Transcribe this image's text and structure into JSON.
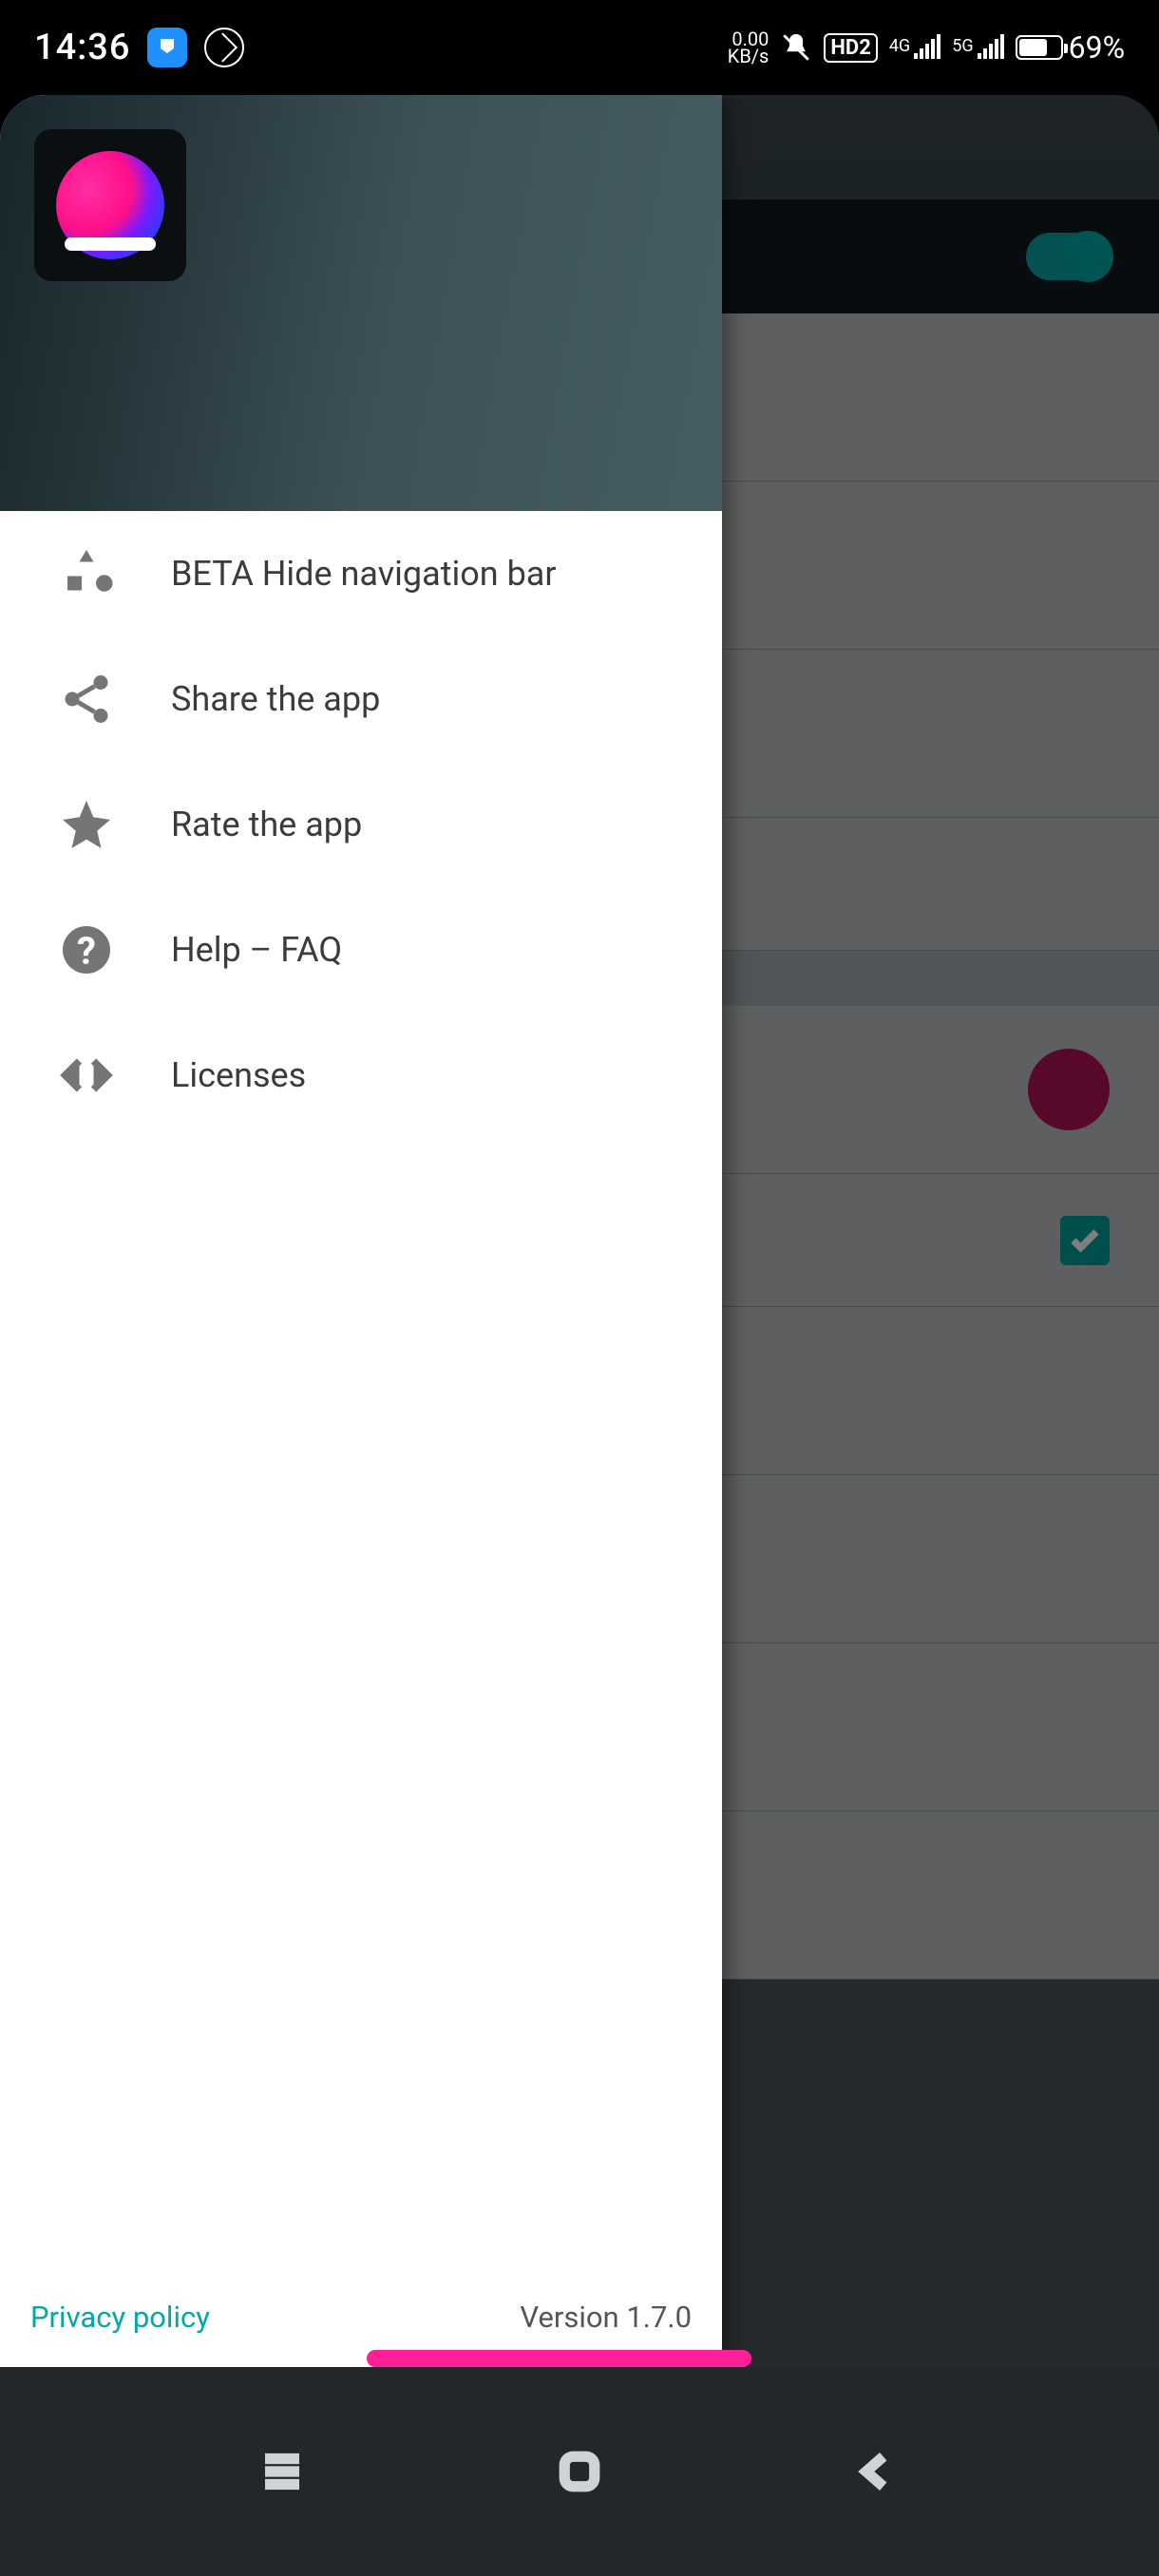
{
  "statusbar": {
    "time": "14:36",
    "data_rate_value": "0.00",
    "data_rate_unit": "KB/s",
    "hd_badge": "HD2",
    "net1": "4G",
    "net2": "5G",
    "battery_pct": "69%"
  },
  "background": {
    "toggle_on": true,
    "checked": true,
    "color_accent": "#b01055"
  },
  "drawer": {
    "items": [
      {
        "label": "BETA Hide navigation bar"
      },
      {
        "label": "Share the app"
      },
      {
        "label": "Rate the app"
      },
      {
        "label": "Help – FAQ"
      },
      {
        "label": "Licenses"
      }
    ],
    "privacy_label": "Privacy policy",
    "version_label": "Version 1.7.0"
  }
}
